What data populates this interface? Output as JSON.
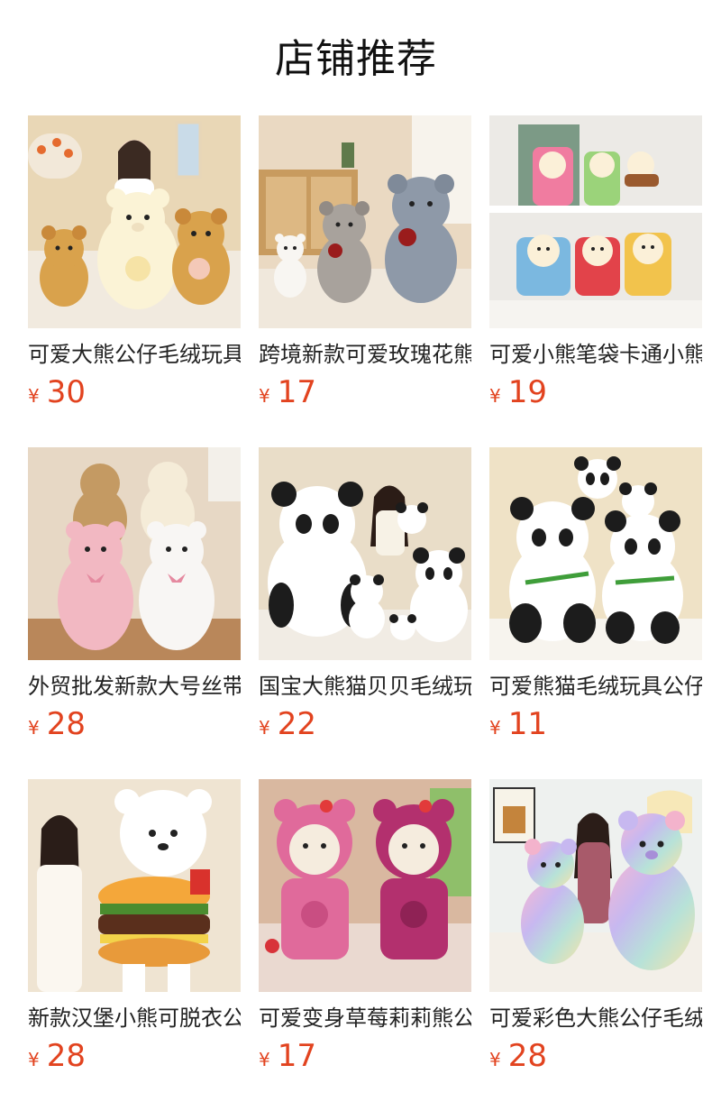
{
  "header": {
    "title": "店铺推荐"
  },
  "colors": {
    "price": "#e2431f",
    "title": "#111111",
    "name": "#222222"
  },
  "products": [
    {
      "name": "可爱大熊公仔毛绒玩具",
      "currency": "¥",
      "price": "30",
      "image": "teddy-bears-yellow-white-image"
    },
    {
      "name": "跨境新款可爱玫瑰花熊",
      "currency": "¥",
      "price": "17",
      "image": "rose-teddy-bears-grey-image"
    },
    {
      "name": "可爱小熊笔袋卡通小熊",
      "currency": "¥",
      "price": "19",
      "image": "bear-pencil-bags-image"
    },
    {
      "name": "外贸批发新款大号丝带熊",
      "currency": "¥",
      "price": "28",
      "image": "large-ribbon-bears-image"
    },
    {
      "name": "国宝大熊猫贝贝毛绒玩具",
      "currency": "¥",
      "price": "22",
      "image": "panda-family-image"
    },
    {
      "name": "可爱熊猫毛绒玩具公仔",
      "currency": "¥",
      "price": "11",
      "image": "bamboo-pandas-image"
    },
    {
      "name": "新款汉堡小熊可脱衣公仔",
      "currency": "¥",
      "price": "28",
      "image": "hamburger-bear-image"
    },
    {
      "name": "可爱变身草莓莉莉熊公仔",
      "currency": "¥",
      "price": "17",
      "image": "strawberry-bears-image"
    },
    {
      "name": "可爱彩色大熊公仔毛绒",
      "currency": "¥",
      "price": "28",
      "image": "rainbow-bears-image"
    }
  ]
}
